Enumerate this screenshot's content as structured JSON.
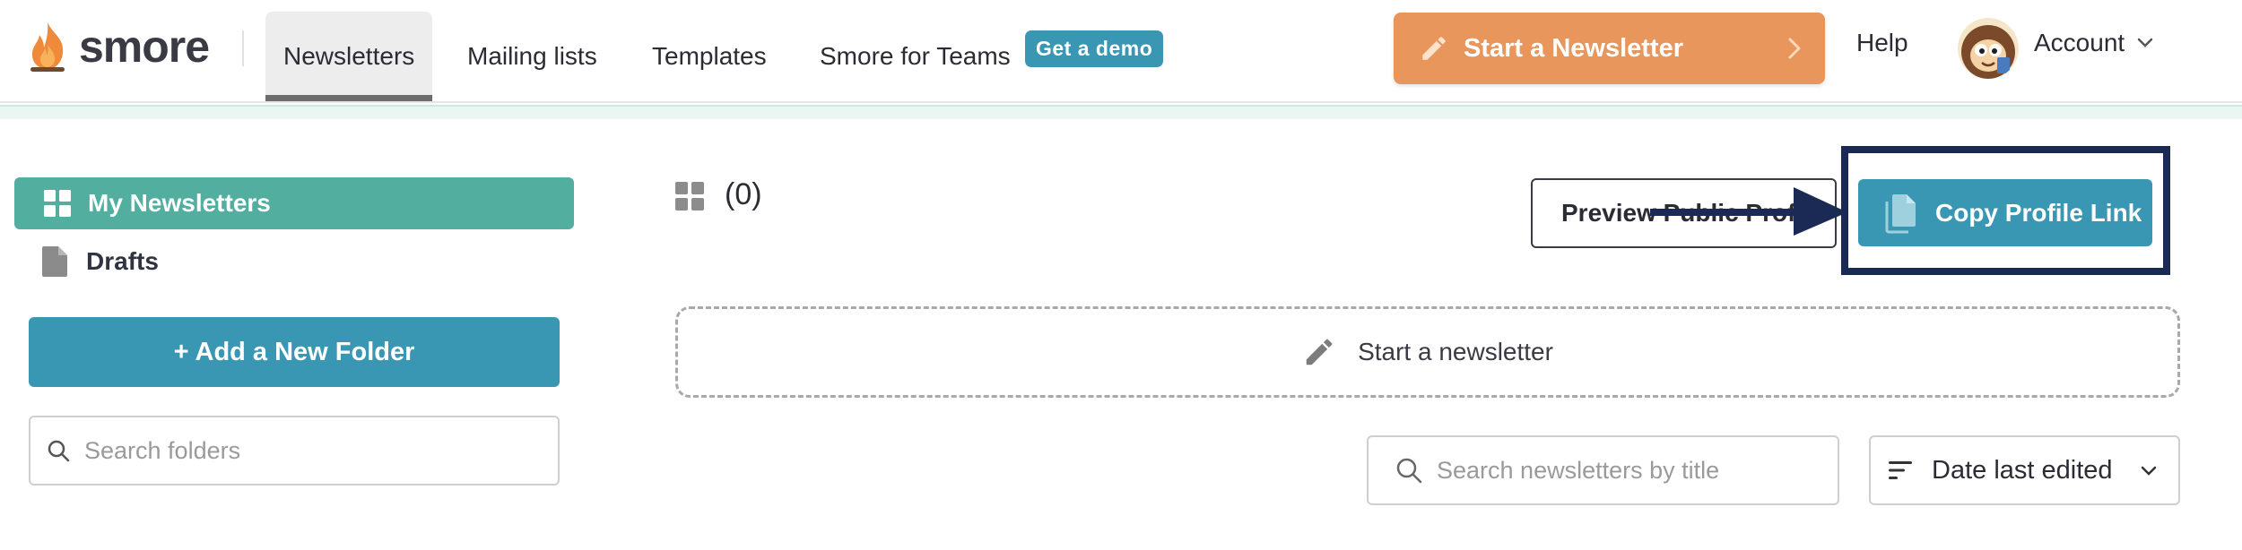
{
  "brand": {
    "name": "smore",
    "accent": "#52ae9f",
    "primary": "#3a97b3",
    "cta": "#e8965c",
    "highlight": "#1b2a55"
  },
  "nav": {
    "items": [
      {
        "label": "Newsletters",
        "active": true
      },
      {
        "label": "Mailing lists"
      },
      {
        "label": "Templates"
      },
      {
        "label": "Smore for Teams"
      }
    ],
    "demo_badge": "Get a demo",
    "start_button": "Start a Newsletter",
    "help": "Help",
    "account": "Account"
  },
  "sidebar": {
    "items": [
      {
        "label": "My Newsletters",
        "icon": "grid-icon",
        "active": true
      },
      {
        "label": "Drafts",
        "icon": "document-icon"
      }
    ],
    "add_folder": "+ Add a New Folder",
    "search_placeholder": "Search folders"
  },
  "main": {
    "count": "(0)",
    "preview_button": "Preview Public Profile",
    "copy_button": "Copy Profile Link",
    "start_newsletter": "Start a newsletter",
    "search_placeholder": "Search newsletters by title",
    "sort_label": "Date last edited"
  }
}
